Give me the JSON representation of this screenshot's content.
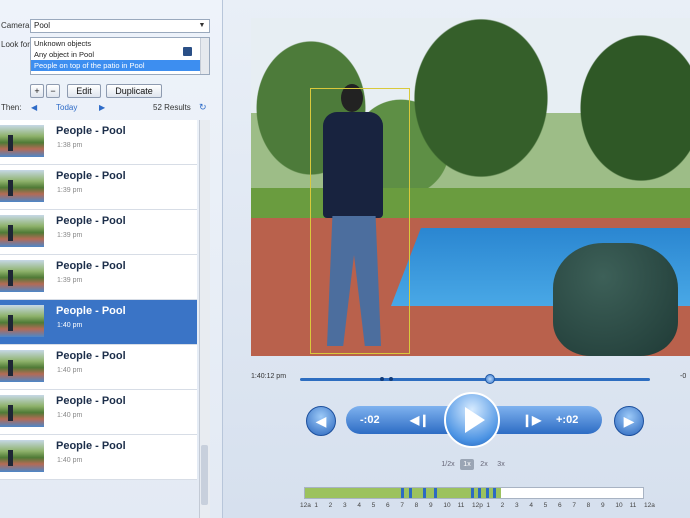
{
  "filter": {
    "camera_label": "Camera:",
    "camera_value": "Pool",
    "lookfor_label": "Look for:",
    "lookfor_options": [
      "Unknown objects",
      "Any object in Pool",
      "People on top of the patio in Pool"
    ],
    "add_label": "+",
    "remove_label": "−",
    "edit_label": "Edit",
    "duplicate_label": "Duplicate"
  },
  "nav": {
    "then_label": "Then:",
    "day_label": "Today",
    "results_label": "52 Results"
  },
  "results": [
    {
      "title": "People - Pool",
      "time": "1:38 pm"
    },
    {
      "title": "People - Pool",
      "time": "1:39 pm"
    },
    {
      "title": "People - Pool",
      "time": "1:39 pm"
    },
    {
      "title": "People - Pool",
      "time": "1:39 pm"
    },
    {
      "title": "People - Pool",
      "time": "1:40 pm"
    },
    {
      "title": "People - Pool",
      "time": "1:40 pm"
    },
    {
      "title": "People - Pool",
      "time": "1:40 pm"
    },
    {
      "title": "People - Pool",
      "time": "1:40 pm"
    }
  ],
  "active_result_index": 4,
  "player": {
    "current_time": "1:40:12 pm",
    "end_label": "-0",
    "back_label": "-:02",
    "forward_label": "+:02",
    "speeds": [
      "1/2x",
      "1x",
      "2x",
      "3x"
    ],
    "active_speed": "1x",
    "scrub_fraction": 0.55
  },
  "timeline": {
    "hours": [
      "12a",
      "1",
      "2",
      "3",
      "4",
      "5",
      "6",
      "7",
      "8",
      "9",
      "10",
      "11",
      "12p",
      "1",
      "2",
      "3",
      "4",
      "5",
      "6",
      "7",
      "8",
      "9",
      "10",
      "11",
      "12a"
    ],
    "recorded_fraction": 0.58
  },
  "colors": {
    "accent": "#3a74c6",
    "timeline_recorded": "#9cc25e",
    "bbox": "#d9c93b"
  }
}
